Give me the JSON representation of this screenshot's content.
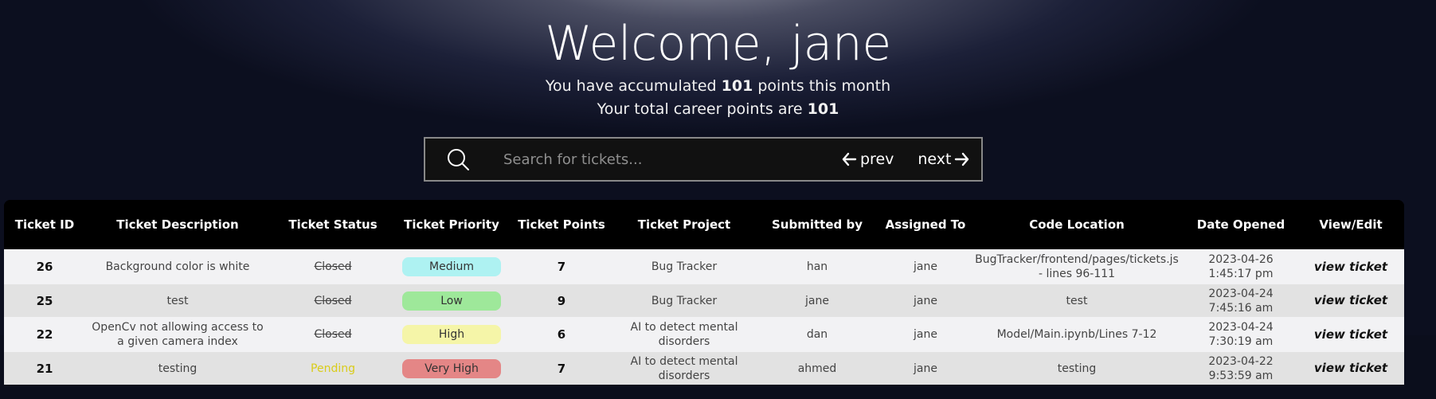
{
  "hero": {
    "welcome": "Welcome, jane",
    "month_prefix": "You have accumulated ",
    "month_points": "101",
    "month_suffix": " points this month",
    "career_prefix": "Your total career points are ",
    "career_points": "101"
  },
  "search": {
    "placeholder": "Search for tickets...",
    "value": "",
    "icon": "search-icon",
    "prev_label": "prev",
    "next_label": "next"
  },
  "table": {
    "headers": [
      "Ticket ID",
      "Ticket Description",
      "Ticket Status",
      "Ticket Priority",
      "Ticket Points",
      "Ticket Project",
      "Submitted by",
      "Assigned To",
      "Code Location",
      "Date Opened",
      "View/Edit"
    ],
    "rows": [
      {
        "id": "26",
        "description": "Background color is white",
        "status": "Closed",
        "priority": "Medium",
        "points": "7",
        "project": "Bug Tracker",
        "submitted_by": "han",
        "assigned_to": "jane",
        "code_location": "BugTracker/frontend/pages/tickets.js - lines 96-111",
        "date_opened": "2023-04-26 1:45:17 pm",
        "action": "view ticket"
      },
      {
        "id": "25",
        "description": "test",
        "status": "Closed",
        "priority": "Low",
        "points": "9",
        "project": "Bug Tracker",
        "submitted_by": "jane",
        "assigned_to": "jane",
        "code_location": "test",
        "date_opened": "2023-04-24 7:45:16 am",
        "action": "view ticket"
      },
      {
        "id": "22",
        "description": "OpenCv not allowing access to a given camera index",
        "status": "Closed",
        "priority": "High",
        "points": "6",
        "project": "AI to detect mental disorders",
        "submitted_by": "dan",
        "assigned_to": "jane",
        "code_location": "Model/Main.ipynb/Lines 7-12",
        "date_opened": "2023-04-24 7:30:19 am",
        "action": "view ticket"
      },
      {
        "id": "21",
        "description": "testing",
        "status": "Pending",
        "priority": "Very High",
        "points": "7",
        "project": "AI to detect mental disorders",
        "submitted_by": "ahmed",
        "assigned_to": "jane",
        "code_location": "testing",
        "date_opened": "2023-04-22 9:53:59 am",
        "action": "view ticket"
      }
    ]
  },
  "colors": {
    "priority_medium": "#aef2f2",
    "priority_low": "#9ee89a",
    "priority_high": "#f5f5a8",
    "priority_very_high": "#e48686",
    "status_pending": "#d9cc1a",
    "table_header_bg": "#000000"
  }
}
